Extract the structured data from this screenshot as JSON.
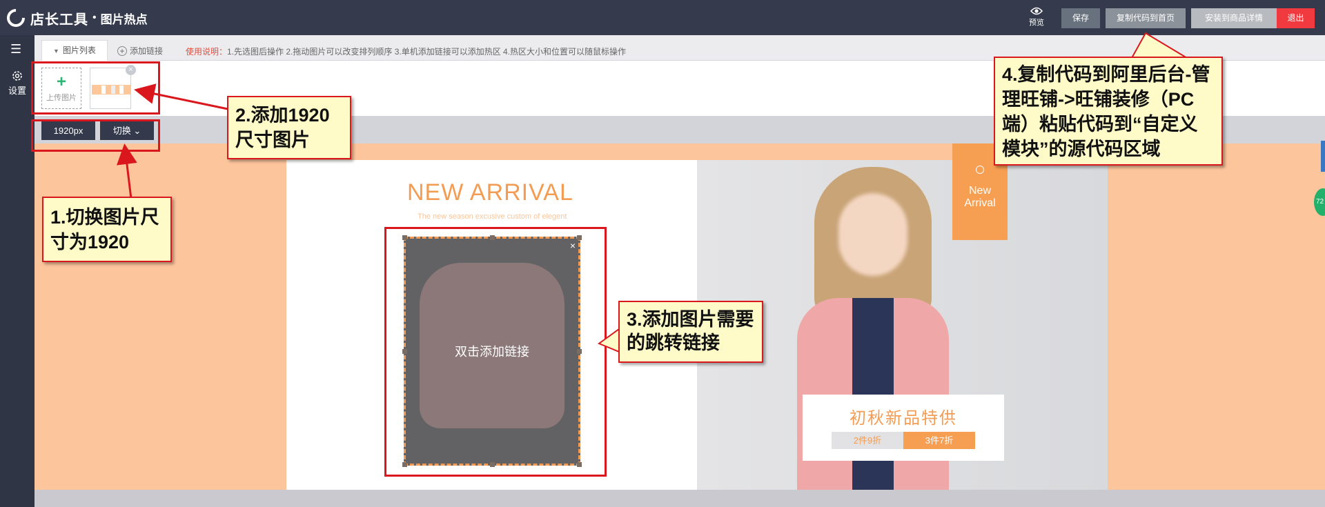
{
  "header": {
    "logo_text": "店长工具",
    "separator": "•",
    "title": "图片热点",
    "preview_label": "预览",
    "save_label": "保存",
    "copy_label": "复制代码到首页",
    "install_label": "安装到商品详情",
    "exit_label": "退出"
  },
  "sidebar": {
    "menu_icon": "list-icon",
    "settings_label": "设置"
  },
  "toolbar": {
    "tab_image_list": "图片列表",
    "add_link": "添加链接",
    "usage_label": "使用说明：",
    "usage_text": "1.先选图后操作 2.拖动图片可以改变排列顺序 3.单机添加链接可以添加热区 4.热区大小和位置可以随鼠标操作"
  },
  "image_list": {
    "upload_label": "上传图片",
    "close_icon": "×"
  },
  "size_bar": {
    "size_value": "1920px",
    "switch_label": "切换"
  },
  "canvas": {
    "new_arrival_title": "NEW ARRIVAL",
    "new_arrival_sub": "The new season excusive custom of elegent",
    "hotspot_text": "双击添加链接",
    "hotspot_close": "×",
    "badge_line1": "New",
    "badge_line2": "Arrival",
    "promo_title": "初秋新品特供",
    "promo_a": "2件9折",
    "promo_b": "3件7折",
    "edge_badge": "72"
  },
  "annotations": {
    "step1": "1.切换图片尺寸为1920",
    "step2": "2.添加1920尺寸图片",
    "step3": "3.添加图片需要的跳转链接",
    "step4": "4.复制代码到阿里后台-管理旺铺->旺铺装修（PC端）粘贴代码到“自定义模块”的源代码区域"
  },
  "colors": {
    "topbar": "#353b4c",
    "accent_orange": "#f39c54",
    "annotation_red": "#d9171d",
    "callout_bg": "#fffbc8",
    "canvas_bg": "#fdc59c"
  }
}
